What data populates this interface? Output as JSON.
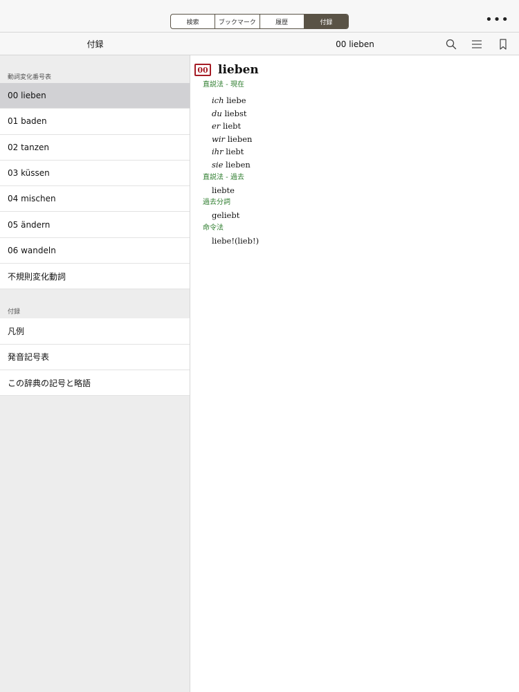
{
  "topbar": {
    "segments": [
      "検索",
      "ブックマーク",
      "履歴",
      "付録"
    ],
    "active_segment": "付録",
    "more_icon": "ellipsis-icon"
  },
  "navbar": {
    "left_title": "付録",
    "center_title": "00 lieben",
    "icons": [
      "search-icon",
      "list-icon",
      "bookmark-icon"
    ]
  },
  "sidebar": {
    "section1_header": "動詞変化番号表",
    "section1_items": [
      "00 lieben",
      "01 baden",
      "02 tanzen",
      "03 küssen",
      "04 mischen",
      "05 ändern",
      "06 wandeln",
      "不規則変化動詞"
    ],
    "selected_item": "00 lieben",
    "section2_header": "付録",
    "section2_items": [
      "凡例",
      "発音記号表",
      "この辞典の記号と略語"
    ]
  },
  "entry": {
    "badge": "00",
    "word": "lieben",
    "present_label": "直説法 - 現在",
    "present": [
      {
        "pronoun": "ich",
        "form": "liebe"
      },
      {
        "pronoun": "du",
        "form": "liebst"
      },
      {
        "pronoun": "er",
        "form": "liebt"
      },
      {
        "pronoun": "wir",
        "form": "lieben"
      },
      {
        "pronoun": "ihr",
        "form": "liebt"
      },
      {
        "pronoun": "sie",
        "form": "lieben"
      }
    ],
    "past_label": "直説法 - 過去",
    "past_form": "liebte",
    "participle_label": "過去分詞",
    "participle_form": "geliebt",
    "imperative_label": "命令法",
    "imperative_form": "liebe!(lieb!)"
  },
  "colors": {
    "accent_dark": "#5a5346",
    "green_label": "#2e7d2e",
    "badge_red": "#a51b25",
    "sidebar_bg": "#ededed",
    "selected_bg": "#d1d1d4"
  }
}
